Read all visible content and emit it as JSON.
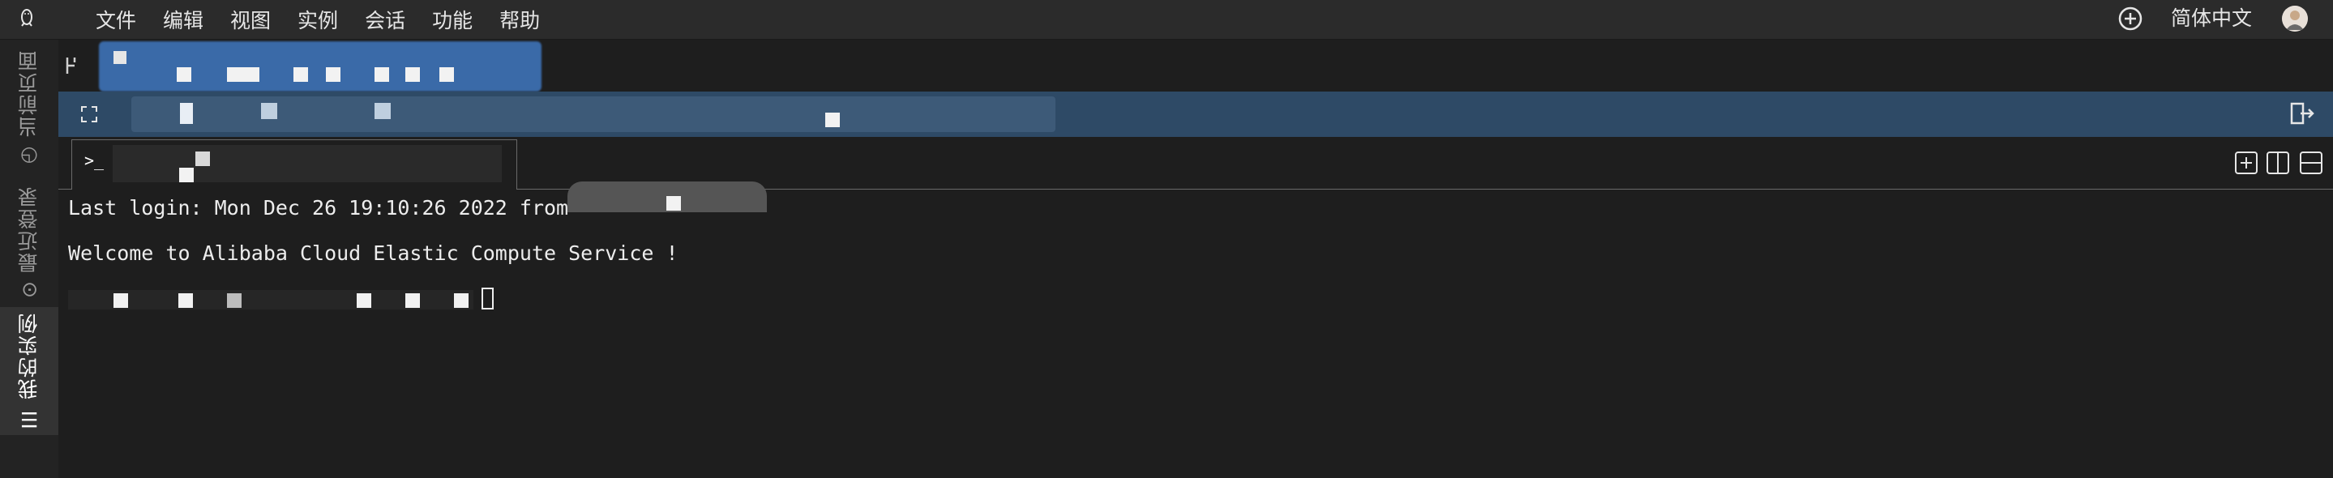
{
  "app": {
    "logo_icon": "penguin-icon"
  },
  "menu": {
    "items": [
      "文件",
      "编辑",
      "视图",
      "实例",
      "会话",
      "功能",
      "帮助"
    ]
  },
  "header_right": {
    "add_icon": "plus-circle-icon",
    "language": "简体中文",
    "avatar_icon": "user-avatar"
  },
  "sidebar": {
    "items": [
      {
        "label": "当前页面",
        "icon": "clock-icon",
        "active": false
      },
      {
        "label": "最近登录",
        "icon": "ellipsis-circle-icon",
        "active": false
      },
      {
        "label": "我的实例",
        "icon": "list-icon",
        "active": true
      }
    ]
  },
  "instance": {
    "expand_icon": "expand-icon",
    "exit_icon": "exit-icon"
  },
  "tabs": [
    {
      "prompt_icon": ">_"
    }
  ],
  "pane_controls": [
    "new-pane-icon",
    "split-vertical-icon",
    "split-horizontal-icon"
  ],
  "terminal": {
    "lines": [
      "Last login: Mon Dec 26 19:10:26 2022 from",
      "Welcome to Alibaba Cloud Elastic Compute Service !"
    ]
  },
  "colors": {
    "background": "#1e1e1e",
    "menubar": "#2b2b2b",
    "instance_bar": "#2e4a66",
    "text": "#ededed"
  }
}
